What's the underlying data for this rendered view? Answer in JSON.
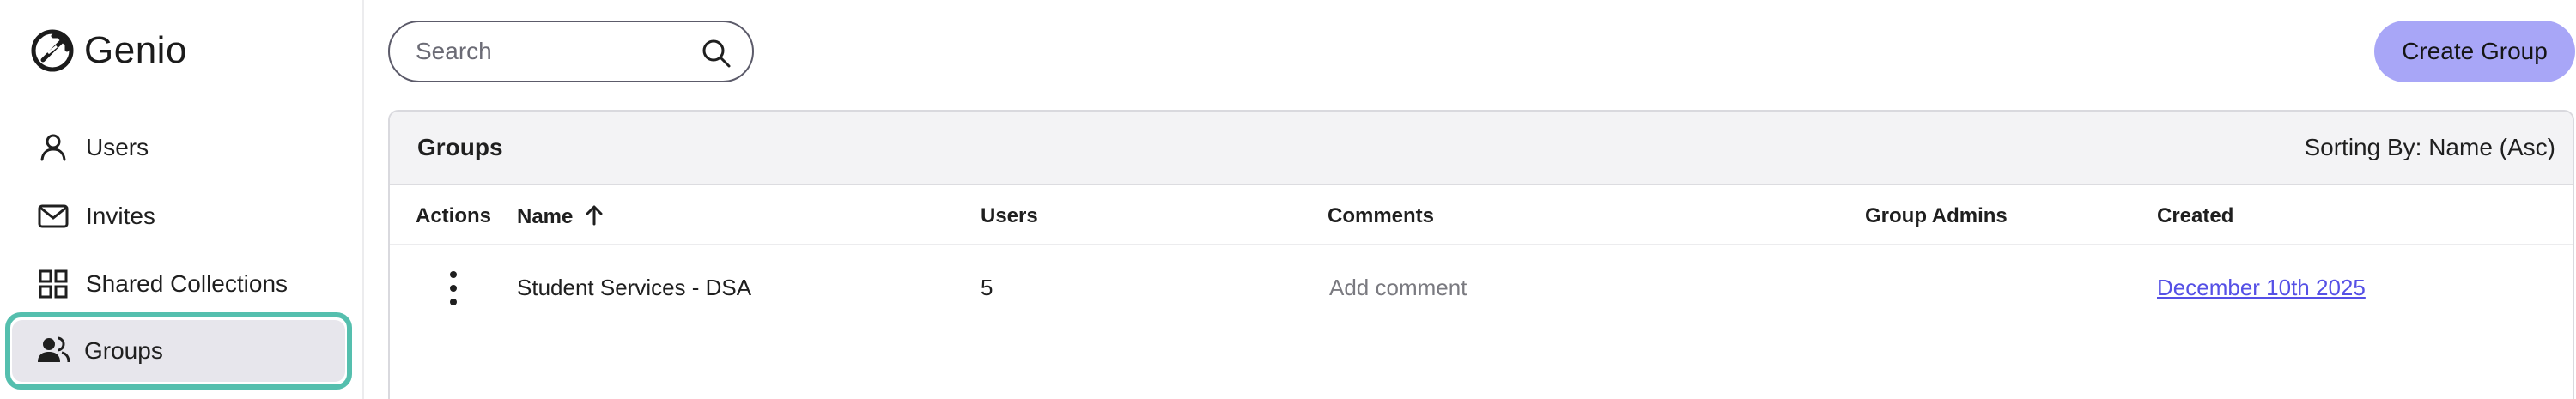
{
  "app": {
    "name": "Genio"
  },
  "sidebar": {
    "items": [
      {
        "label": "Users",
        "icon": "user-icon"
      },
      {
        "label": "Invites",
        "icon": "mail-icon"
      },
      {
        "label": "Shared Collections",
        "icon": "grid-icon"
      },
      {
        "label": "Groups",
        "icon": "people-icon",
        "active": true
      }
    ]
  },
  "topbar": {
    "search_placeholder": "Search",
    "create_label": "Create Group"
  },
  "groups_table": {
    "title": "Groups",
    "sorting_text": "Sorting By: Name (Asc)",
    "columns": [
      "Actions",
      "Name",
      "Users",
      "Comments",
      "Group Admins",
      "Created"
    ],
    "rows": [
      {
        "name": "Student Services - DSA",
        "users": "5",
        "comment": "Add comment",
        "group_admins": "",
        "created": "December 10th 2025"
      }
    ]
  },
  "colors": {
    "accent_button": "#a8a6f7",
    "active_outline": "#55bfae",
    "active_bg": "#e7e6ec",
    "link": "#5550e6"
  }
}
